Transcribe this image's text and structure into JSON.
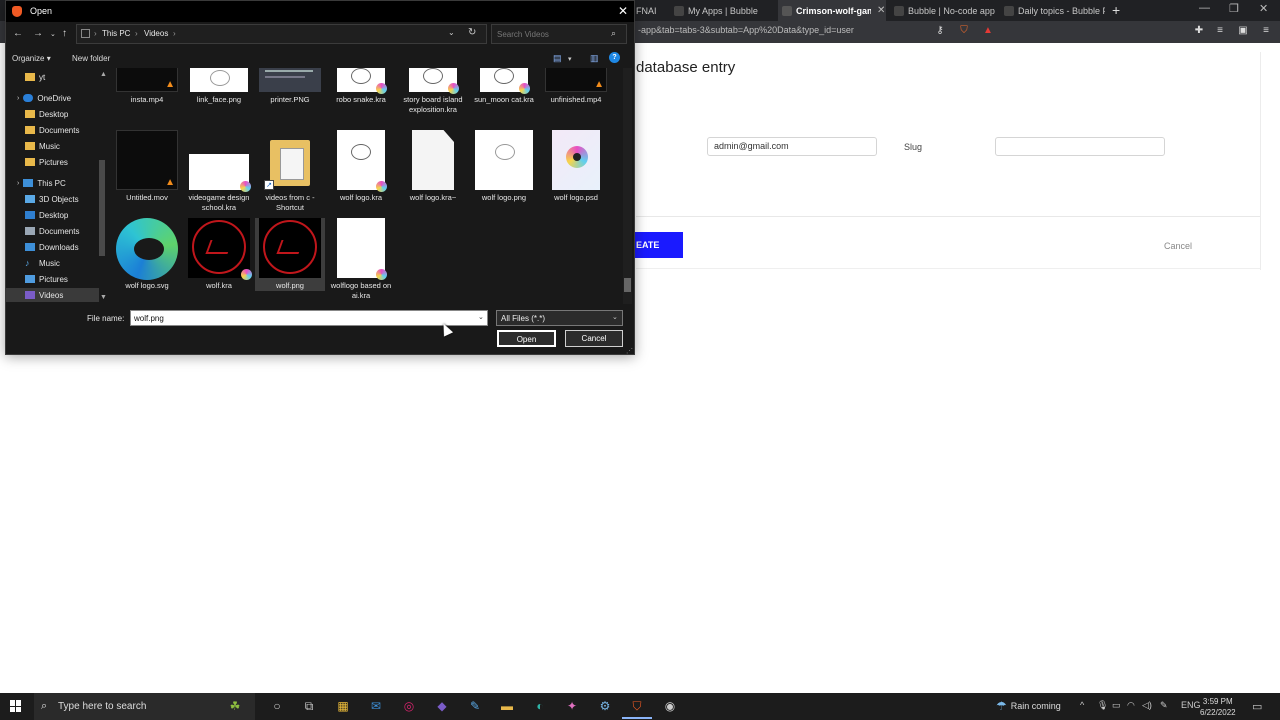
{
  "browser": {
    "tabs": [
      {
        "label": "FNAI",
        "active": false
      },
      {
        "label": "My Apps | Bubble",
        "active": false
      },
      {
        "label": "Crimson-wolf-game",
        "active": true
      },
      {
        "label": "Bubble | No-code apps",
        "active": false
      },
      {
        "label": "Daily topics - Bubble Fo",
        "active": false
      }
    ],
    "new_tab": "+",
    "window_controls": {
      "minimize": "—",
      "restore": "❐",
      "close": "✕"
    },
    "url": "-app&tab=tabs-3&subtab=App%20Data&type_id=user"
  },
  "page": {
    "title": "database entry",
    "email_value": "admin@gmail.com",
    "slug_label": "Slug",
    "slug_value": "",
    "create_label": "EATE",
    "cancel_label": "Cancel"
  },
  "dialog": {
    "title": "Open",
    "close": "✕",
    "breadcrumbs": [
      "This PC",
      "Videos"
    ],
    "search_placeholder": "Search Videos",
    "toolbar": {
      "organize": "Organize",
      "new_folder": "New folder",
      "help": "?"
    },
    "nav_items": [
      {
        "label": "yt",
        "type": "folder"
      },
      {
        "label": "OneDrive",
        "type": "cloud"
      },
      {
        "label": "Desktop",
        "type": "folder"
      },
      {
        "label": "Documents",
        "type": "folder"
      },
      {
        "label": "Music",
        "type": "folder"
      },
      {
        "label": "Pictures",
        "type": "folder"
      },
      {
        "label": "This PC",
        "type": "pc"
      },
      {
        "label": "3D Objects",
        "type": "3d"
      },
      {
        "label": "Desktop",
        "type": "desktop"
      },
      {
        "label": "Documents",
        "type": "docs"
      },
      {
        "label": "Downloads",
        "type": "download"
      },
      {
        "label": "Music",
        "type": "music"
      },
      {
        "label": "Pictures",
        "type": "pictures"
      },
      {
        "label": "Videos",
        "type": "videos"
      }
    ],
    "files": [
      {
        "name": "insta.mp4",
        "kind": "video-vlc"
      },
      {
        "name": "link_face.png",
        "kind": "sketch"
      },
      {
        "name": "printer.PNG",
        "kind": "screenshot"
      },
      {
        "name": "robo snake.kra",
        "kind": "kra-sketch"
      },
      {
        "name": "story board island explosition.kra",
        "kind": "kra-sketch"
      },
      {
        "name": "sun_moon cat.kra",
        "kind": "kra-sketch"
      },
      {
        "name": "unfinished.mp4",
        "kind": "video-vlc"
      },
      {
        "name": "Untitled.mov",
        "kind": "video-vlc"
      },
      {
        "name": "videogame design school.kra",
        "kind": "kra-white"
      },
      {
        "name": "videos from c - Shortcut",
        "kind": "folder-shortcut"
      },
      {
        "name": "wolf logo.kra",
        "kind": "kra-sketch"
      },
      {
        "name": "wolf logo.kra~",
        "kind": "blank"
      },
      {
        "name": "wolf logo.png",
        "kind": "sketch"
      },
      {
        "name": "wolf logo.psd",
        "kind": "psd"
      },
      {
        "name": "wolf logo.svg",
        "kind": "edge"
      },
      {
        "name": "wolf.kra",
        "kind": "wolf-red-kra"
      },
      {
        "name": "wolf.png",
        "kind": "wolf-red"
      },
      {
        "name": "wolflogo based on ai.kra",
        "kind": "kra-white"
      }
    ],
    "selected_file": "wolf.png",
    "file_name_label": "File name:",
    "file_name_value": "wolf.png",
    "file_type": "All Files (*.*)",
    "open_label": "Open",
    "cancel_label": "Cancel"
  },
  "taskbar": {
    "search_placeholder": "Type here to search",
    "weather": "Rain coming",
    "language": "ENG",
    "time": "3:59 PM",
    "date": "6/22/2022"
  },
  "colors": {
    "dialog_bg": "#191919",
    "accent_blue": "#1a1aff",
    "taskbar_bg": "#1c1c1c",
    "wolf_red": "#c0161b"
  }
}
